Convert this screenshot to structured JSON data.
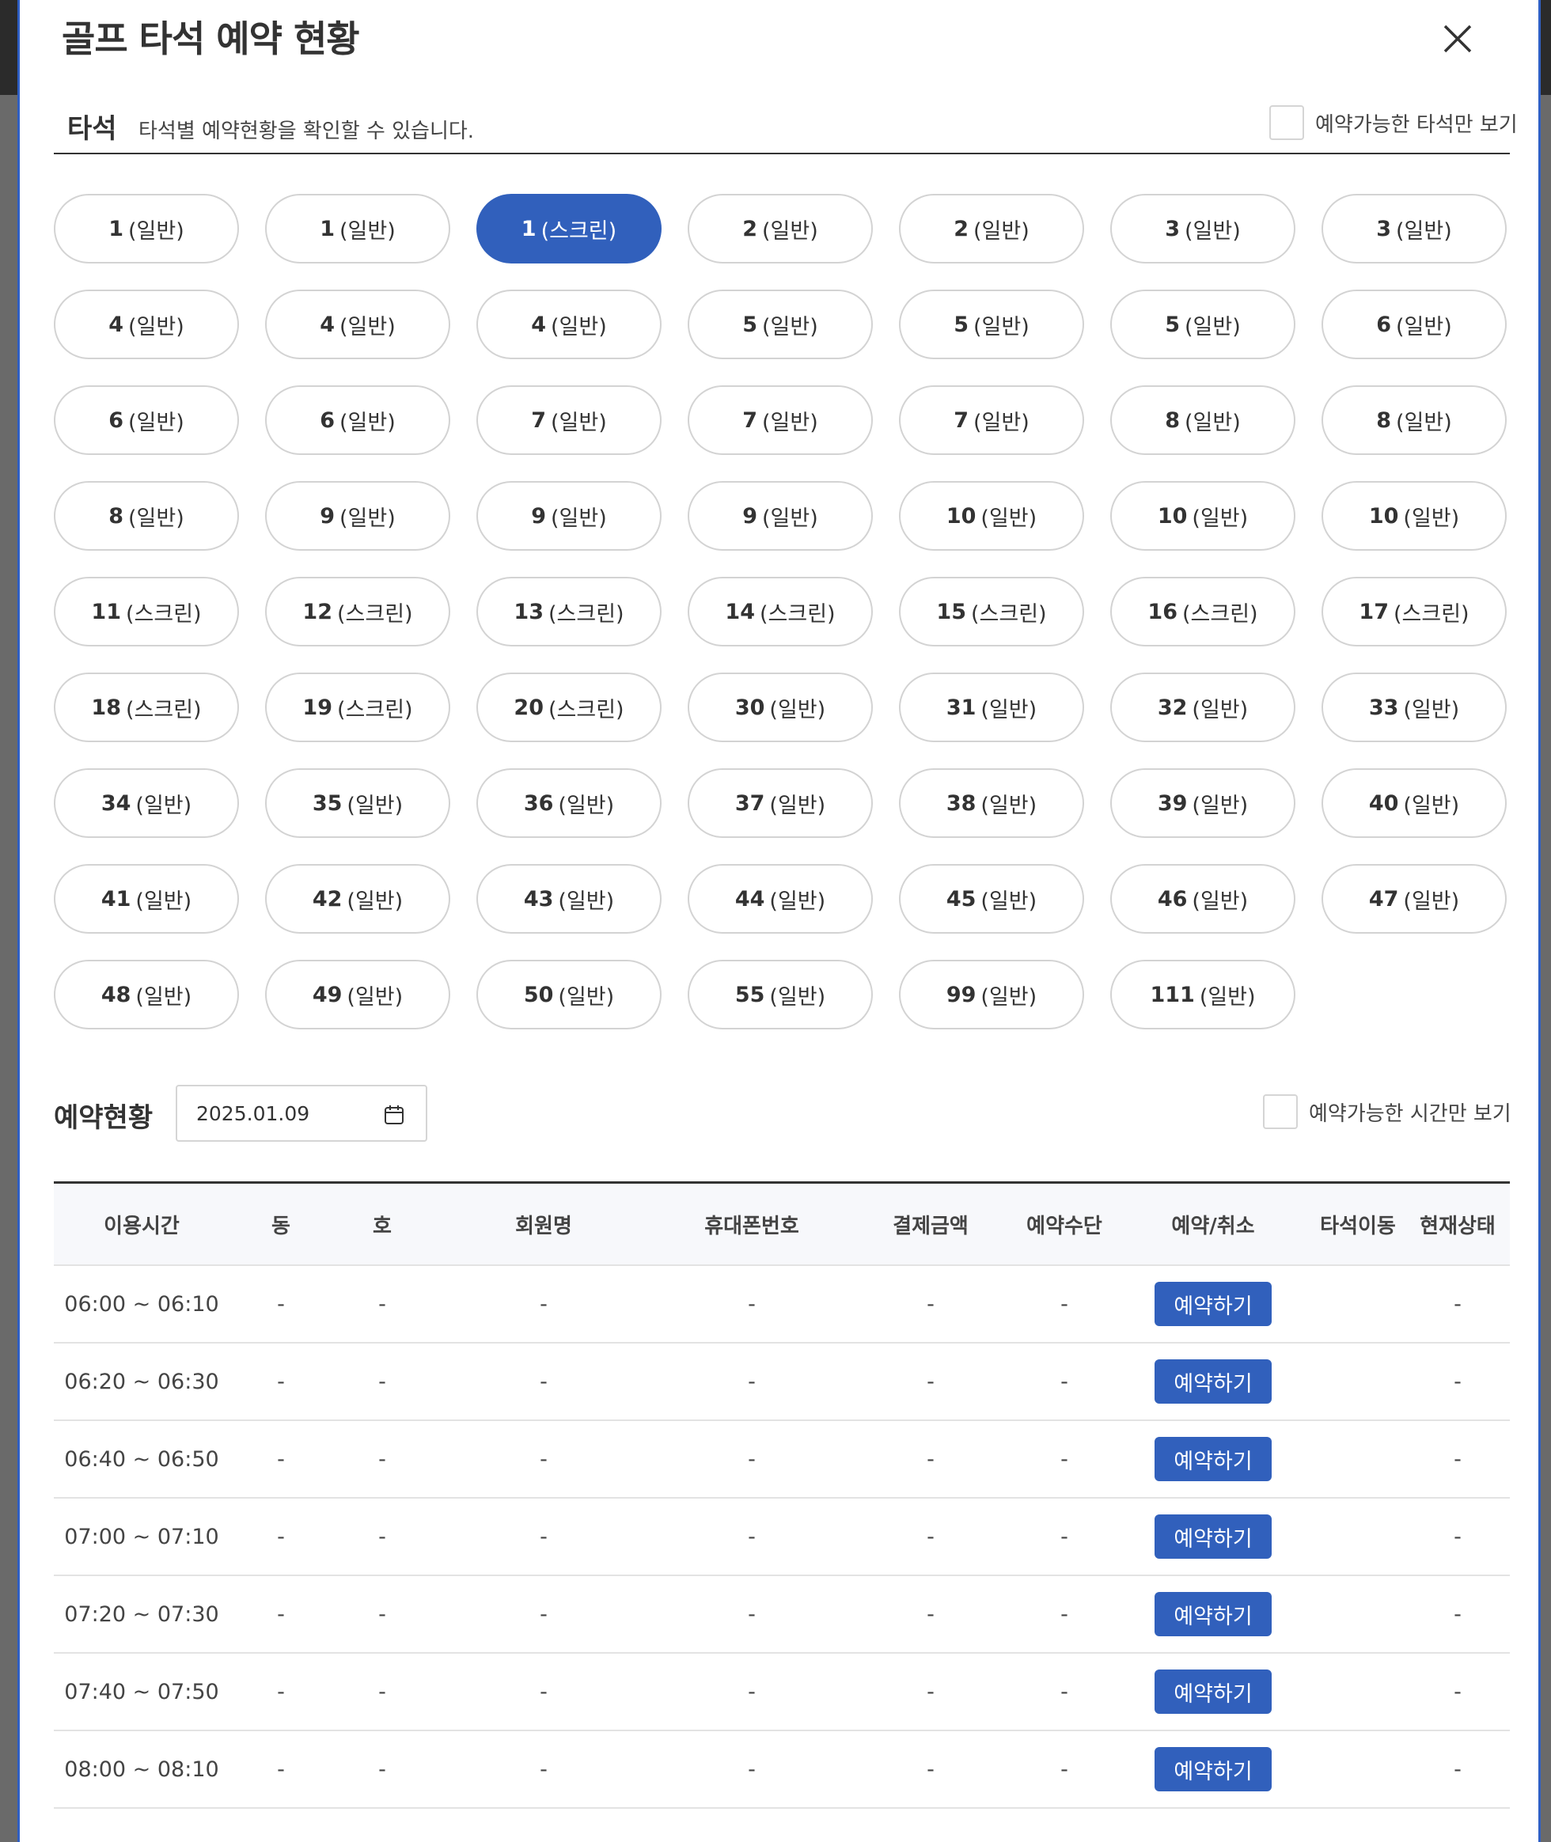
{
  "modal": {
    "title": "골프 타석 예약 현황"
  },
  "seat_section": {
    "heading": "타석",
    "description": "타석별 예약현황을 확인할 수 있습니다.",
    "filter_label": "예약가능한 타석만 보기"
  },
  "seats": [
    {
      "num": "1",
      "type": "(일반)"
    },
    {
      "num": "1",
      "type": "(일반)"
    },
    {
      "num": "1",
      "type": "(스크린)",
      "active": true
    },
    {
      "num": "2",
      "type": "(일반)"
    },
    {
      "num": "2",
      "type": "(일반)"
    },
    {
      "num": "3",
      "type": "(일반)"
    },
    {
      "num": "3",
      "type": "(일반)"
    },
    {
      "num": "4",
      "type": "(일반)"
    },
    {
      "num": "4",
      "type": "(일반)"
    },
    {
      "num": "4",
      "type": "(일반)"
    },
    {
      "num": "5",
      "type": "(일반)"
    },
    {
      "num": "5",
      "type": "(일반)"
    },
    {
      "num": "5",
      "type": "(일반)"
    },
    {
      "num": "6",
      "type": "(일반)"
    },
    {
      "num": "6",
      "type": "(일반)"
    },
    {
      "num": "6",
      "type": "(일반)"
    },
    {
      "num": "7",
      "type": "(일반)"
    },
    {
      "num": "7",
      "type": "(일반)"
    },
    {
      "num": "7",
      "type": "(일반)"
    },
    {
      "num": "8",
      "type": "(일반)"
    },
    {
      "num": "8",
      "type": "(일반)"
    },
    {
      "num": "8",
      "type": "(일반)"
    },
    {
      "num": "9",
      "type": "(일반)"
    },
    {
      "num": "9",
      "type": "(일반)"
    },
    {
      "num": "9",
      "type": "(일반)"
    },
    {
      "num": "10",
      "type": "(일반)"
    },
    {
      "num": "10",
      "type": "(일반)"
    },
    {
      "num": "10",
      "type": "(일반)"
    },
    {
      "num": "11",
      "type": "(스크린)"
    },
    {
      "num": "12",
      "type": "(스크린)"
    },
    {
      "num": "13",
      "type": "(스크린)"
    },
    {
      "num": "14",
      "type": "(스크린)"
    },
    {
      "num": "15",
      "type": "(스크린)"
    },
    {
      "num": "16",
      "type": "(스크린)"
    },
    {
      "num": "17",
      "type": "(스크린)"
    },
    {
      "num": "18",
      "type": "(스크린)"
    },
    {
      "num": "19",
      "type": "(스크린)"
    },
    {
      "num": "20",
      "type": "(스크린)"
    },
    {
      "num": "30",
      "type": "(일반)"
    },
    {
      "num": "31",
      "type": "(일반)"
    },
    {
      "num": "32",
      "type": "(일반)"
    },
    {
      "num": "33",
      "type": "(일반)"
    },
    {
      "num": "34",
      "type": "(일반)"
    },
    {
      "num": "35",
      "type": "(일반)"
    },
    {
      "num": "36",
      "type": "(일반)"
    },
    {
      "num": "37",
      "type": "(일반)"
    },
    {
      "num": "38",
      "type": "(일반)"
    },
    {
      "num": "39",
      "type": "(일반)"
    },
    {
      "num": "40",
      "type": "(일반)"
    },
    {
      "num": "41",
      "type": "(일반)"
    },
    {
      "num": "42",
      "type": "(일반)"
    },
    {
      "num": "43",
      "type": "(일반)"
    },
    {
      "num": "44",
      "type": "(일반)"
    },
    {
      "num": "45",
      "type": "(일반)"
    },
    {
      "num": "46",
      "type": "(일반)"
    },
    {
      "num": "47",
      "type": "(일반)"
    },
    {
      "num": "48",
      "type": "(일반)"
    },
    {
      "num": "49",
      "type": "(일반)"
    },
    {
      "num": "50",
      "type": "(일반)"
    },
    {
      "num": "55",
      "type": "(일반)"
    },
    {
      "num": "99",
      "type": "(일반)"
    },
    {
      "num": "111",
      "type": "(일반)"
    }
  ],
  "reservation": {
    "heading": "예약현황",
    "date": "2025.01.09",
    "filter_label": "예약가능한 시간만 보기",
    "columns": [
      "이용시간",
      "동",
      "호",
      "회원명",
      "휴대폰번호",
      "결제금액",
      "예약수단",
      "예약/취소",
      "타석이동",
      "현재상태"
    ],
    "book_label": "예약하기",
    "rows": [
      {
        "time": "06:00 ~ 06:10",
        "dong": "-",
        "ho": "-",
        "name": "-",
        "phone": "-",
        "amount": "-",
        "method": "-",
        "move": "",
        "status": "-"
      },
      {
        "time": "06:20 ~ 06:30",
        "dong": "-",
        "ho": "-",
        "name": "-",
        "phone": "-",
        "amount": "-",
        "method": "-",
        "move": "",
        "status": "-"
      },
      {
        "time": "06:40 ~ 06:50",
        "dong": "-",
        "ho": "-",
        "name": "-",
        "phone": "-",
        "amount": "-",
        "method": "-",
        "move": "",
        "status": "-"
      },
      {
        "time": "07:00 ~ 07:10",
        "dong": "-",
        "ho": "-",
        "name": "-",
        "phone": "-",
        "amount": "-",
        "method": "-",
        "move": "",
        "status": "-"
      },
      {
        "time": "07:20 ~ 07:30",
        "dong": "-",
        "ho": "-",
        "name": "-",
        "phone": "-",
        "amount": "-",
        "method": "-",
        "move": "",
        "status": "-"
      },
      {
        "time": "07:40 ~ 07:50",
        "dong": "-",
        "ho": "-",
        "name": "-",
        "phone": "-",
        "amount": "-",
        "method": "-",
        "move": "",
        "status": "-"
      },
      {
        "time": "08:00 ~ 08:10",
        "dong": "-",
        "ho": "-",
        "name": "-",
        "phone": "-",
        "amount": "-",
        "method": "-",
        "move": "",
        "status": "-"
      }
    ]
  },
  "icons": {
    "close": "close-icon",
    "calendar": "calendar-icon"
  },
  "colors": {
    "accent": "#3160bc",
    "modal_border": "#2f5fc4"
  }
}
